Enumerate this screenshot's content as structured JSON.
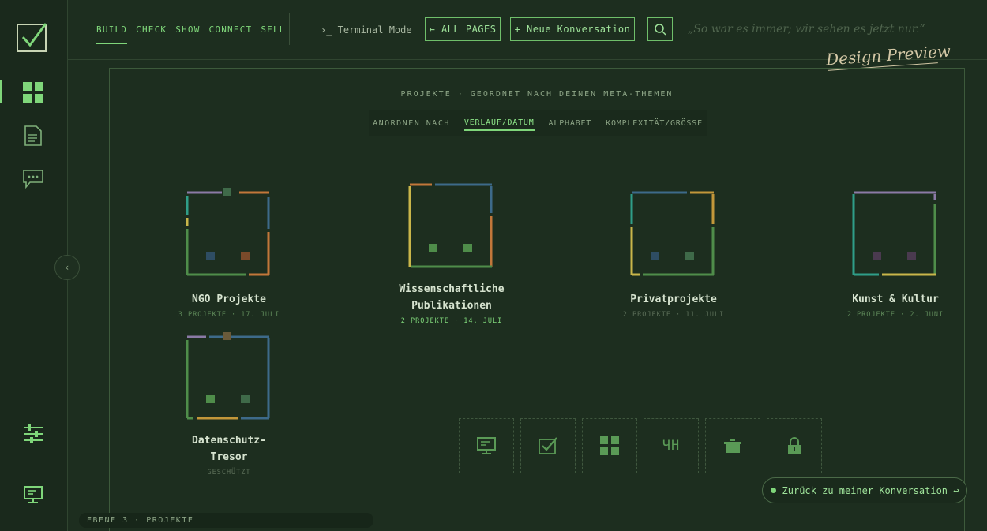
{
  "colors": {
    "accent": "#7fd67a",
    "background": "#1d2e1f",
    "sidebar": "#1a291c",
    "blue": "#3d6a8a",
    "orange": "#c2773a",
    "yellow": "#c9b64a",
    "purple": "#8b7aa6",
    "teal": "#2f9e88",
    "green": "#4f8d4a"
  },
  "sidebar": {
    "items": [
      {
        "icon": "checkbox-logo-icon"
      },
      {
        "icon": "grid-icon"
      },
      {
        "icon": "document-icon"
      },
      {
        "icon": "chat-icon"
      },
      {
        "icon": "sliders-icon"
      },
      {
        "icon": "monitor-icon"
      }
    ],
    "collapse_glyph": "‹"
  },
  "header": {
    "nav": [
      "BUILD",
      "CHECK",
      "SHOW",
      "CONNECT",
      "SELL"
    ],
    "terminal_label": "›_ Terminal Mode",
    "all_pages_label": "← ALL PAGES",
    "new_conversation_label": "+ Neue Konversation",
    "quote": "„So war es immer; wir sehen es jetzt nur.“",
    "design_preview": "Design Preview"
  },
  "main": {
    "title": "PROJEKTE · GEORDNET NACH DEINEN META-THEMEN",
    "sort": {
      "label": "ANORDNEN NACH",
      "options": [
        "VERLAUF/DATUM",
        "ALPHABET",
        "KOMPLEXITÄT/GRÖSSE"
      ]
    },
    "projects": [
      {
        "name_line1": "NGO Projekte",
        "name_line2": "",
        "meta": "3 PROJEKTE · 17. JULI"
      },
      {
        "name_line1": "Wissenschaftliche",
        "name_line2": "Publikationen",
        "meta": "2 PROJEKTE · 14. JULI"
      },
      {
        "name_line1": "Privatprojekte",
        "name_line2": "",
        "meta": "2 PROJEKTE · 11. JULI"
      },
      {
        "name_line1": "Kunst & Kultur",
        "name_line2": "",
        "meta": "2 PROJEKTE · 2. JUNI"
      },
      {
        "name_line1": "Datenschutz-",
        "name_line2": "Tresor",
        "meta": "GESCHÜTZT"
      }
    ],
    "dock": [
      {
        "icon": "monitor-icon"
      },
      {
        "icon": "checkbox-icon"
      },
      {
        "icon": "grid-icon"
      },
      {
        "icon": "glyph-icon",
        "text": "ЧН"
      },
      {
        "icon": "pot-icon"
      },
      {
        "icon": "lock-icon"
      }
    ],
    "back_button": "Zurück zu meiner Konversation ↩",
    "breadcrumb": "EBENE 3 · PROJEKTE"
  }
}
